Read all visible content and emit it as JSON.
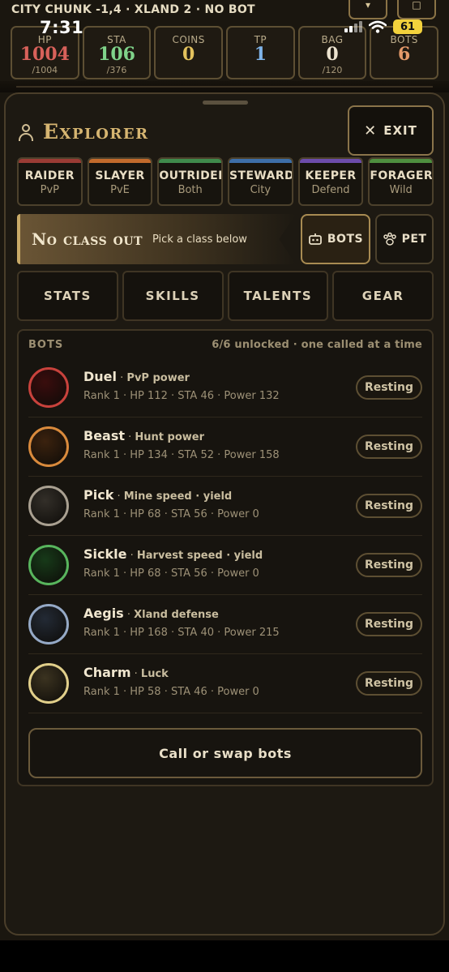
{
  "status_bar": {
    "time": "7:31",
    "battery": "61"
  },
  "location_line": "CITY CHUNK -1,4 · XLAND 2 · NO BOT",
  "stats": [
    {
      "label": "HP",
      "value": "1004",
      "sub": "/1004",
      "color": "#d8615a"
    },
    {
      "label": "STA",
      "value": "106",
      "sub": "/376",
      "color": "#7fd38a"
    },
    {
      "label": "COINS",
      "value": "0",
      "sub": "",
      "color": "#e3c25d"
    },
    {
      "label": "TP",
      "value": "1",
      "sub": "",
      "color": "#7fb4ea"
    },
    {
      "label": "BAG",
      "value": "0",
      "sub": "/120",
      "color": "#ece3cf"
    },
    {
      "label": "BOTS",
      "value": "6",
      "sub": "",
      "color": "#e59a6a"
    }
  ],
  "sheet": {
    "title": "Explorer",
    "exit_label": "EXIT",
    "classes": [
      {
        "name": "RAIDER",
        "role": "PvP",
        "color": "#9a3b34"
      },
      {
        "name": "SLAYER",
        "role": "PvE",
        "color": "#c26a2c"
      },
      {
        "name": "OUTRIDER",
        "role": "Both",
        "color": "#3f8a4c"
      },
      {
        "name": "STEWARD",
        "role": "City",
        "color": "#3d6ea8"
      },
      {
        "name": "KEEPER",
        "role": "Defend",
        "color": "#6c4cab"
      },
      {
        "name": "FORAGER",
        "role": "Wild",
        "color": "#4e8f3f"
      }
    ],
    "banner": {
      "title": "No class out",
      "hint": "Pick a class below"
    },
    "bots_toggle": "BOTS",
    "pet_toggle": "PET",
    "tabs": [
      "STATS",
      "SKILLS",
      "TALENTS",
      "GEAR"
    ],
    "bots_panel": {
      "heading": "BOTS",
      "meta": "6/6 unlocked · one called at a time",
      "bots": [
        {
          "name": "Duel",
          "role": "PvP power",
          "stats": "Rank 1 · HP 112 · STA 46 · Power 132",
          "status": "Resting",
          "color": "#c8423c",
          "fill": "#3a0d0d"
        },
        {
          "name": "Beast",
          "role": "Hunt power",
          "stats": "Rank 1 · HP 134 · STA 52 · Power 158",
          "status": "Resting",
          "color": "#d98a3c",
          "fill": "#3b220e"
        },
        {
          "name": "Pick",
          "role": "Mine speed · yield",
          "stats": "Rank 1 · HP 68 · STA 56 · Power 0",
          "status": "Resting",
          "color": "#a9a091",
          "fill": "#332f29"
        },
        {
          "name": "Sickle",
          "role": "Harvest speed · yield",
          "stats": "Rank 1 · HP 68 · STA 56 · Power 0",
          "status": "Resting",
          "color": "#58b55d",
          "fill": "#173a19"
        },
        {
          "name": "Aegis",
          "role": "Xland defense",
          "stats": "Rank 1 · HP 168 · STA 40 · Power 215",
          "status": "Resting",
          "color": "#95a9c6",
          "fill": "#232a35"
        },
        {
          "name": "Charm",
          "role": "Luck",
          "stats": "Rank 1 · HP 58 · STA 46 · Power 0",
          "status": "Resting",
          "color": "#e1cf8a",
          "fill": "#3b3320"
        }
      ],
      "call_button": "Call or swap bots"
    }
  }
}
